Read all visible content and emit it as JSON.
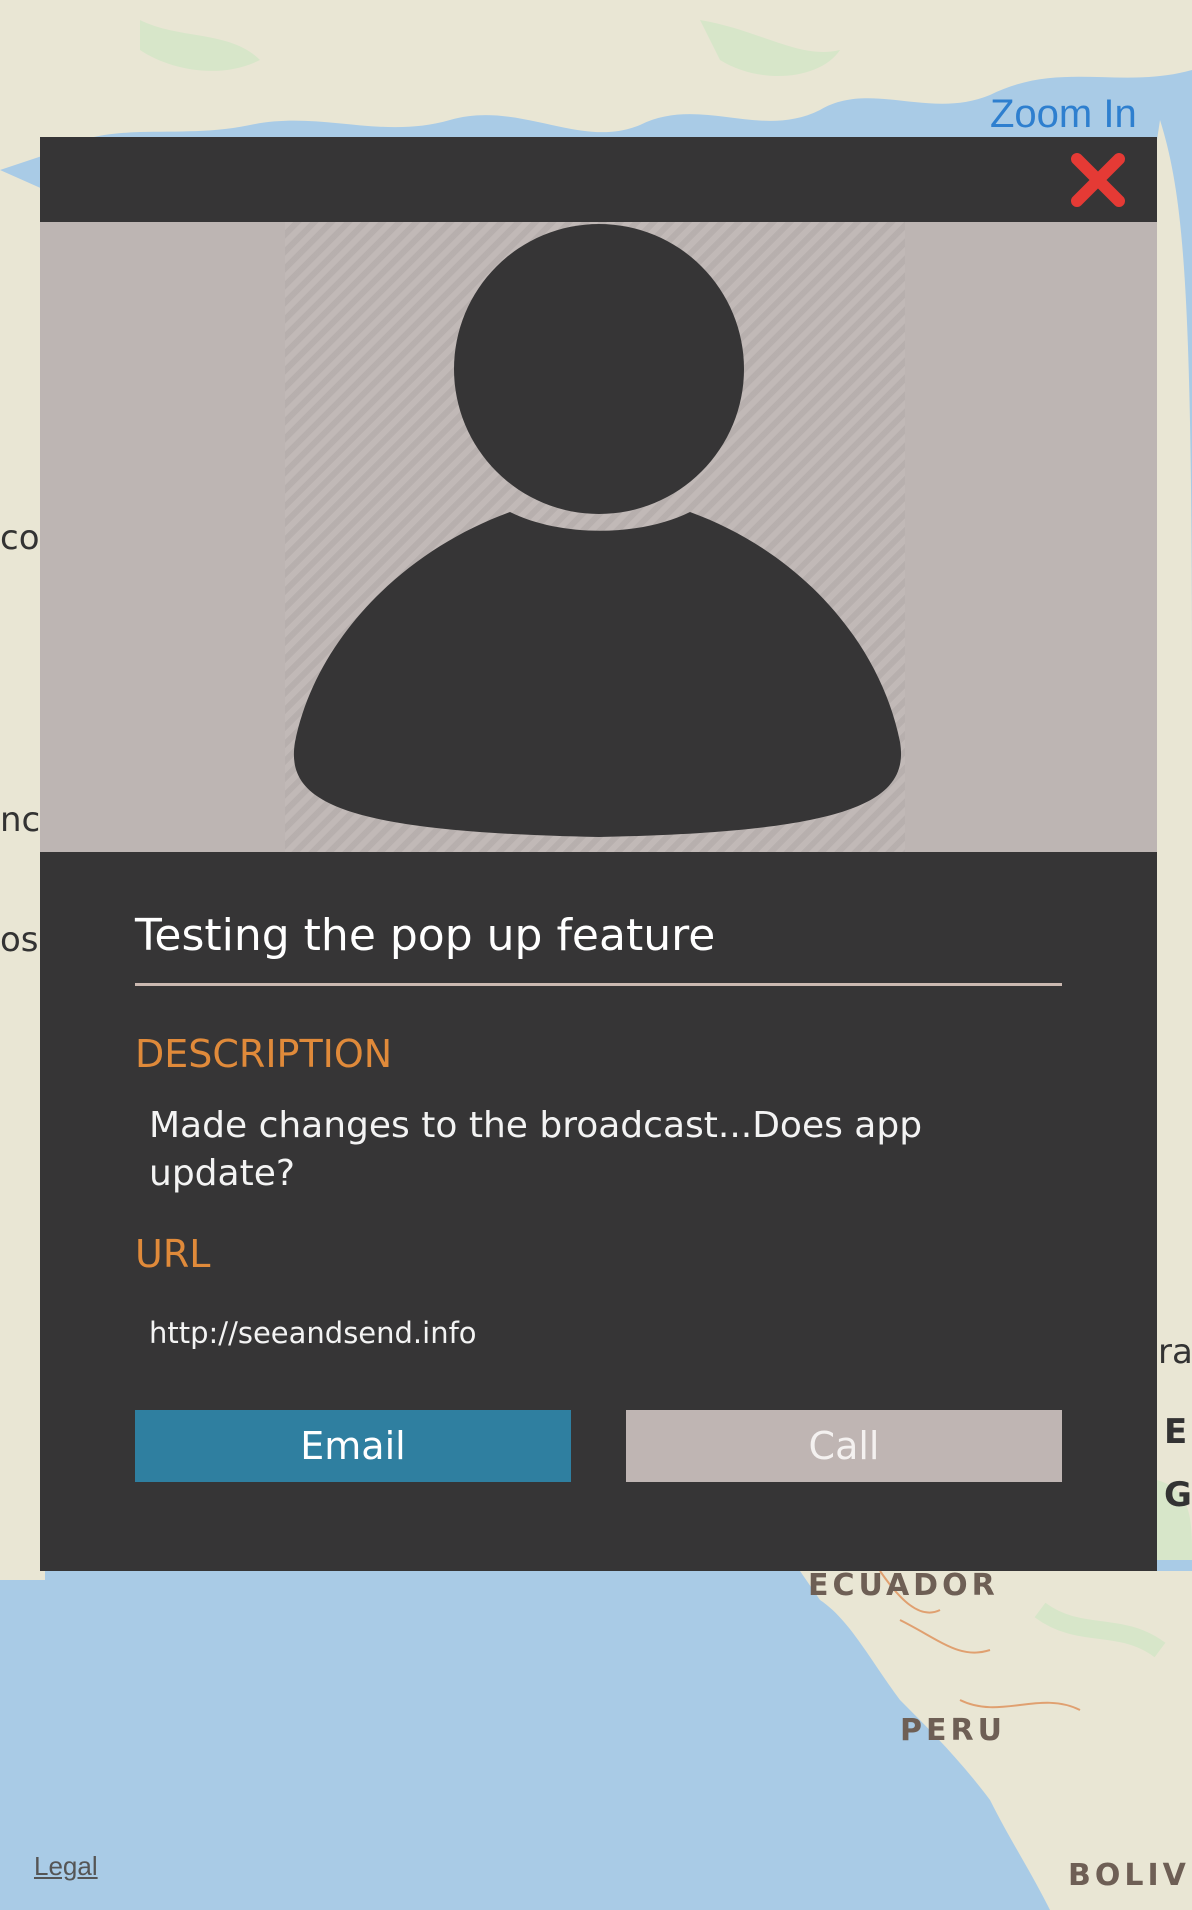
{
  "map": {
    "zoom_in_label": "Zoom In",
    "legal_label": "Legal",
    "country_labels": [
      "ECUADOR",
      "PERU",
      "BOLIV"
    ],
    "edge_fragments": [
      "co",
      "nc",
      "os",
      "ra",
      "E",
      "G"
    ],
    "colors": {
      "water": "#a9cbe6",
      "land": "#eae4d6",
      "border": "#e0a070"
    }
  },
  "popup": {
    "close_icon": "close-icon",
    "avatar_icon": "person-silhouette-icon",
    "title": "Testing the pop up feature",
    "description_label": "DESCRIPTION",
    "description": "Made changes to the broadcast...Does app update?",
    "url_label": "URL",
    "url": "http://seeandsend.info",
    "email_label": "Email",
    "call_label": "Call",
    "colors": {
      "background": "#363536",
      "accent": "#e08a3a",
      "email_button": "#2f7fa0",
      "call_button": "#bfb5b3",
      "close": "#e53a35"
    }
  }
}
